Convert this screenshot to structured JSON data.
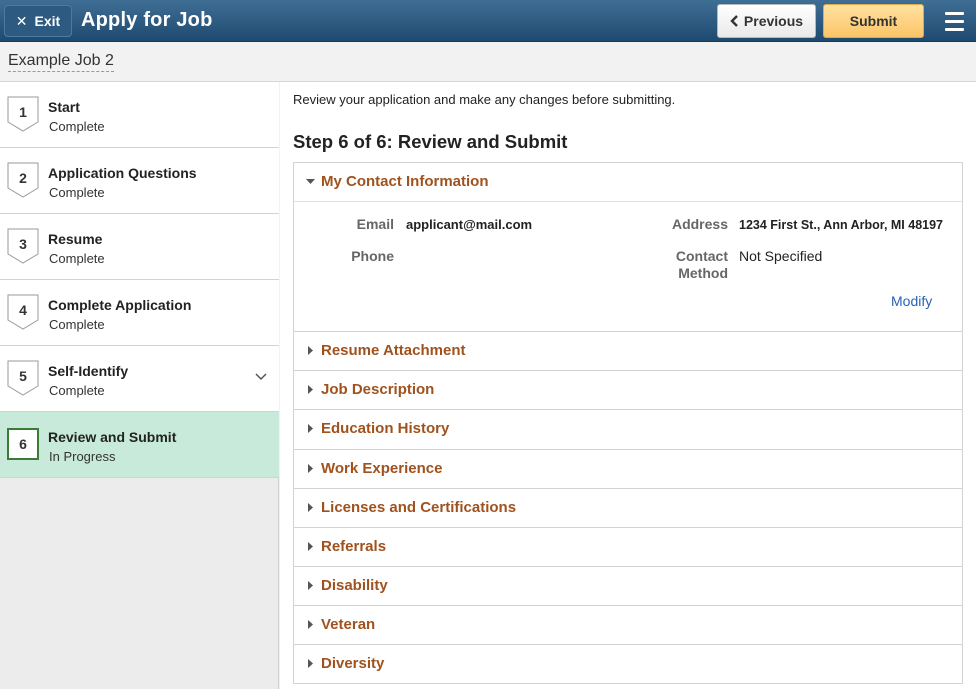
{
  "header": {
    "exit_label": "Exit",
    "title": "Apply for Job",
    "previous_label": "Previous",
    "submit_label": "Submit"
  },
  "subheader": {
    "job_name": "Example Job 2"
  },
  "steps": [
    {
      "num": "1",
      "title": "Start",
      "status": "Complete"
    },
    {
      "num": "2",
      "title": "Application Questions",
      "status": "Complete"
    },
    {
      "num": "3",
      "title": "Resume",
      "status": "Complete"
    },
    {
      "num": "4",
      "title": "Complete Application",
      "status": "Complete"
    },
    {
      "num": "5",
      "title": "Self-Identify",
      "status": "Complete"
    },
    {
      "num": "6",
      "title": "Review and Submit",
      "status": "In Progress"
    }
  ],
  "main": {
    "instructions": "Review your application and make any changes before submitting.",
    "heading": "Step 6 of 6: Review and Submit",
    "contact": {
      "title": "My Contact Information",
      "email_label": "Email",
      "email_value": "applicant@mail.com",
      "phone_label": "Phone",
      "address_label": "Address",
      "address_value": "1234 First St., Ann Arbor, MI 48197",
      "contact_method_label_1": "Contact",
      "contact_method_label_2": "Method",
      "contact_method_value": "Not Specified",
      "modify_label": "Modify"
    },
    "sections": [
      "Resume Attachment",
      "Job Description",
      "Education History",
      "Work Experience",
      "Licenses and Certifications",
      "Referrals",
      "Disability",
      "Veteran",
      "Diversity"
    ]
  },
  "colors": {
    "header_bg": "#2c5a80",
    "active_step_bg": "#c8eada",
    "section_title": "#a0521e",
    "link": "#2962b5",
    "submit_bg": "#fcc468"
  }
}
